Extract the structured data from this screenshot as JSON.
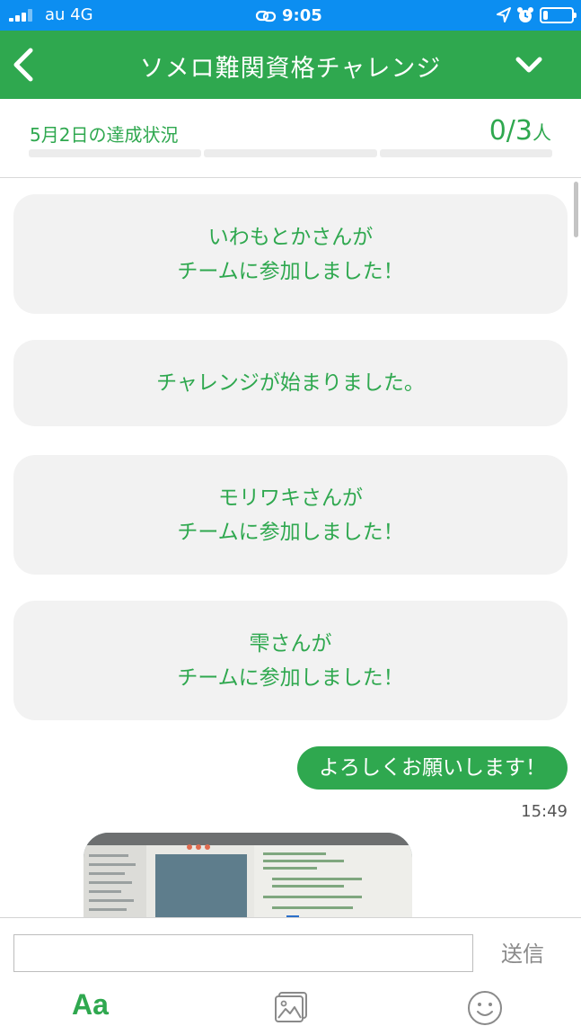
{
  "status_bar": {
    "carrier": "au  4G",
    "time": "9:05",
    "battery_level": 0.18,
    "icons": [
      "signal-icon",
      "link-icon",
      "location-arrow-icon",
      "alarm-icon",
      "battery-icon"
    ]
  },
  "header": {
    "title": "ソメロ難関資格チャレンジ",
    "icons": [
      "back-chevron-icon",
      "chevron-down-icon"
    ]
  },
  "progress": {
    "label": "5月2日の達成状況",
    "count": "0/3",
    "unit": "人",
    "achieved": 0,
    "total": 3
  },
  "messages": {
    "system": [
      {
        "line1": "いわもとかさんが",
        "line2": "チームに参加しました！"
      },
      {
        "line1": "チャレンジが始まりました。",
        "line2": ""
      },
      {
        "line1": "モリワキさんが",
        "line2": "チームに参加しました！"
      },
      {
        "line1": "雫さんが",
        "line2": "チームに参加しました！"
      }
    ],
    "my_message": {
      "text": "よろしくお願いします！",
      "time": "15:49"
    },
    "photo_icon": "photo-thumbnail"
  },
  "input": {
    "placeholder": "",
    "send_label": "送信",
    "aa_label": "Aa",
    "icons": [
      "image-icon",
      "emoji-icon"
    ]
  },
  "colors": {
    "accent_green": "#2fa84f",
    "status_blue": "#0c8ef1"
  }
}
